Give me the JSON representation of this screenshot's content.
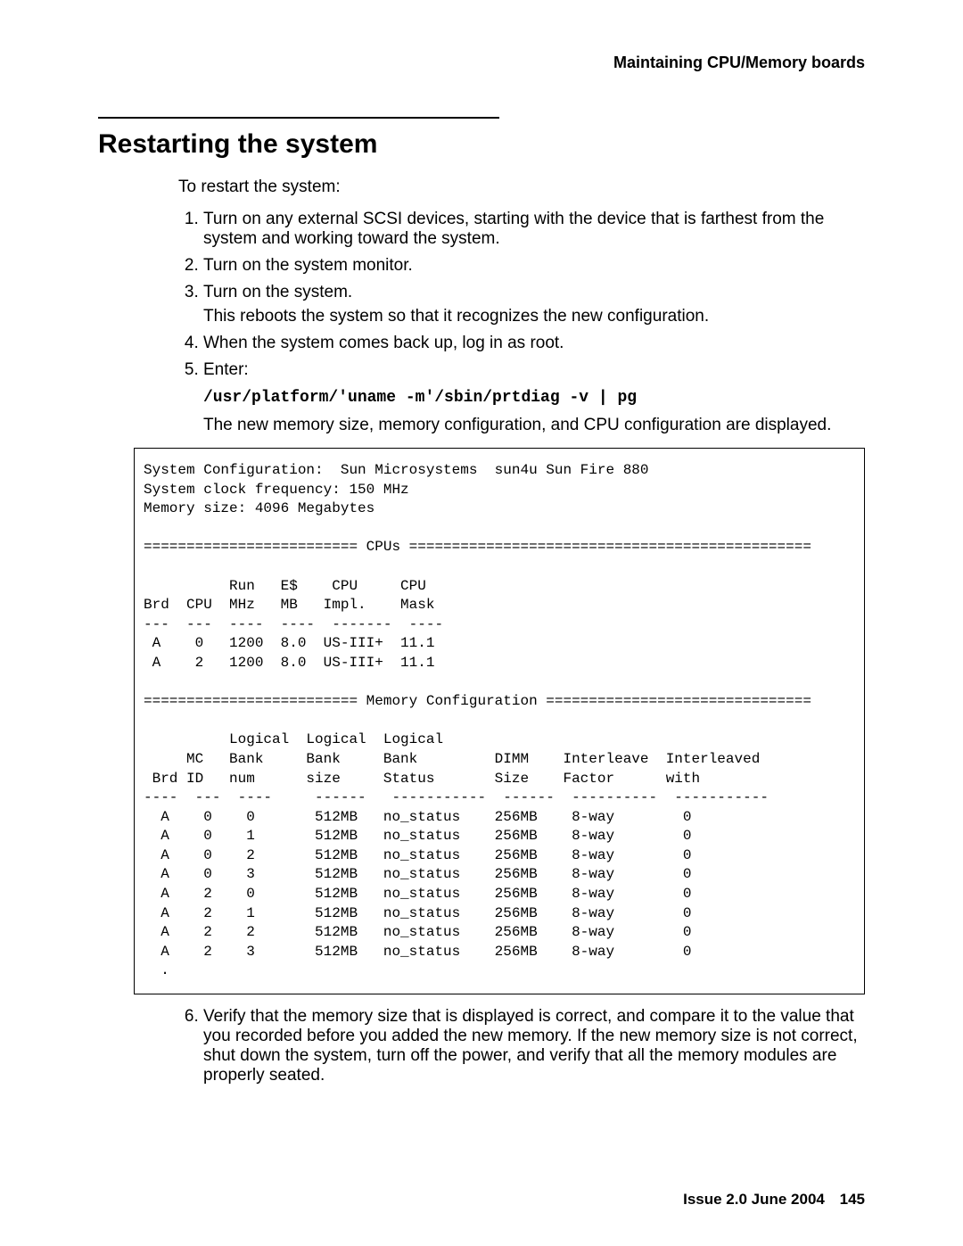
{
  "header": {
    "running": "Maintaining CPU/Memory boards"
  },
  "title": "Restarting the system",
  "lead": "To restart the system:",
  "steps": {
    "s1": "Turn on any external SCSI devices, starting with the device that is farthest from the system and working toward the system.",
    "s2": "Turn on the system monitor.",
    "s3": "Turn on the system.",
    "s3_sub": "This reboots the system so that it recognizes the new configuration.",
    "s4": "When the system comes back up, log in as root.",
    "s5": "Enter:",
    "s5_cmd": "/usr/platform/'uname -m'/sbin/prtdiag -v | pg",
    "s5_after": "The new memory size, memory configuration, and CPU configuration are displayed.",
    "s6": "Verify that the memory size that is displayed is correct, and compare it to the value that you recorded before you added the new memory. If the new memory size is not correct, shut down the system, turn off the power, and verify that all the memory modules are properly seated."
  },
  "terminal": "System Configuration:  Sun Microsystems  sun4u Sun Fire 880\nSystem clock frequency: 150 MHz\nMemory size: 4096 Megabytes\n\n========================= CPUs ===============================================\n\n          Run   E$    CPU     CPU\nBrd  CPU  MHz   MB   Impl.    Mask\n---  ---  ----  ----  -------  ----\n A    0   1200  8.0  US-III+  11.1\n A    2   1200  8.0  US-III+  11.1\n\n========================= Memory Configuration ===============================\n\n          Logical  Logical  Logical\n     MC   Bank     Bank     Bank         DIMM    Interleave  Interleaved\n Brd ID   num      size     Status       Size    Factor      with\n----  ---  ----     ------   -----------  ------  ----------  -----------\n  A    0    0       512MB   no_status    256MB    8-way        0\n  A    0    1       512MB   no_status    256MB    8-way        0\n  A    0    2       512MB   no_status    256MB    8-way        0\n  A    0    3       512MB   no_status    256MB    8-way        0\n  A    2    0       512MB   no_status    256MB    8-way        0\n  A    2    1       512MB   no_status    256MB    8-way        0\n  A    2    2       512MB   no_status    256MB    8-way        0\n  A    2    3       512MB   no_status    256MB    8-way        0\n  .",
  "footer": {
    "issue": "Issue 2.0   June 2004",
    "page": "145"
  }
}
